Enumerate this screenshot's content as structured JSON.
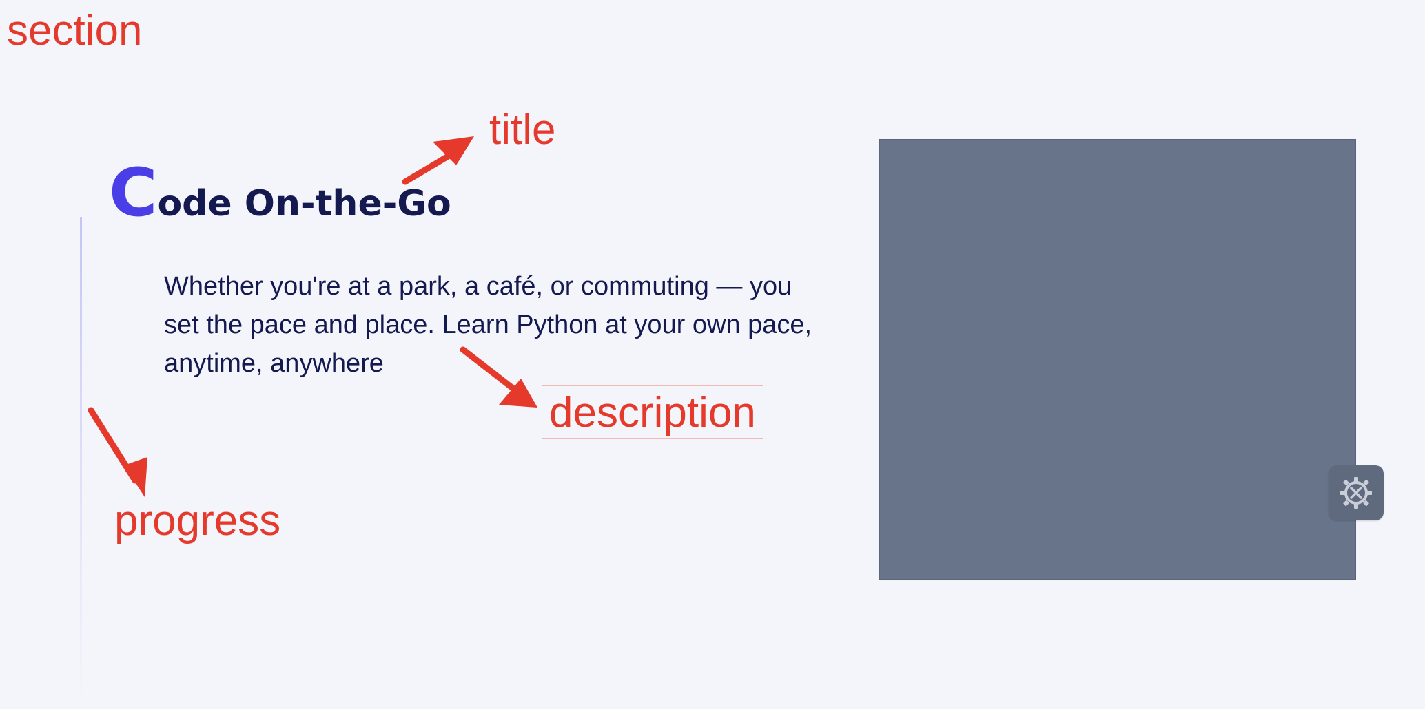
{
  "annotations": {
    "section": "section",
    "title": "title",
    "description": "description",
    "progress": "progress"
  },
  "hero": {
    "title_dropcap": "C",
    "title_rest": "ode On-the-Go",
    "description": "Whether you're at a park, a café, or commuting — you set the pace and place. Learn Python at your own pace, anytime, anywhere"
  },
  "settings": {
    "icon": "gear-wrench-icon"
  },
  "colors": {
    "background": "#f3f5fb",
    "annotation": "#e5392b",
    "title": "#14194f",
    "accent": "#4a3fe6",
    "media_placeholder": "#687489"
  }
}
